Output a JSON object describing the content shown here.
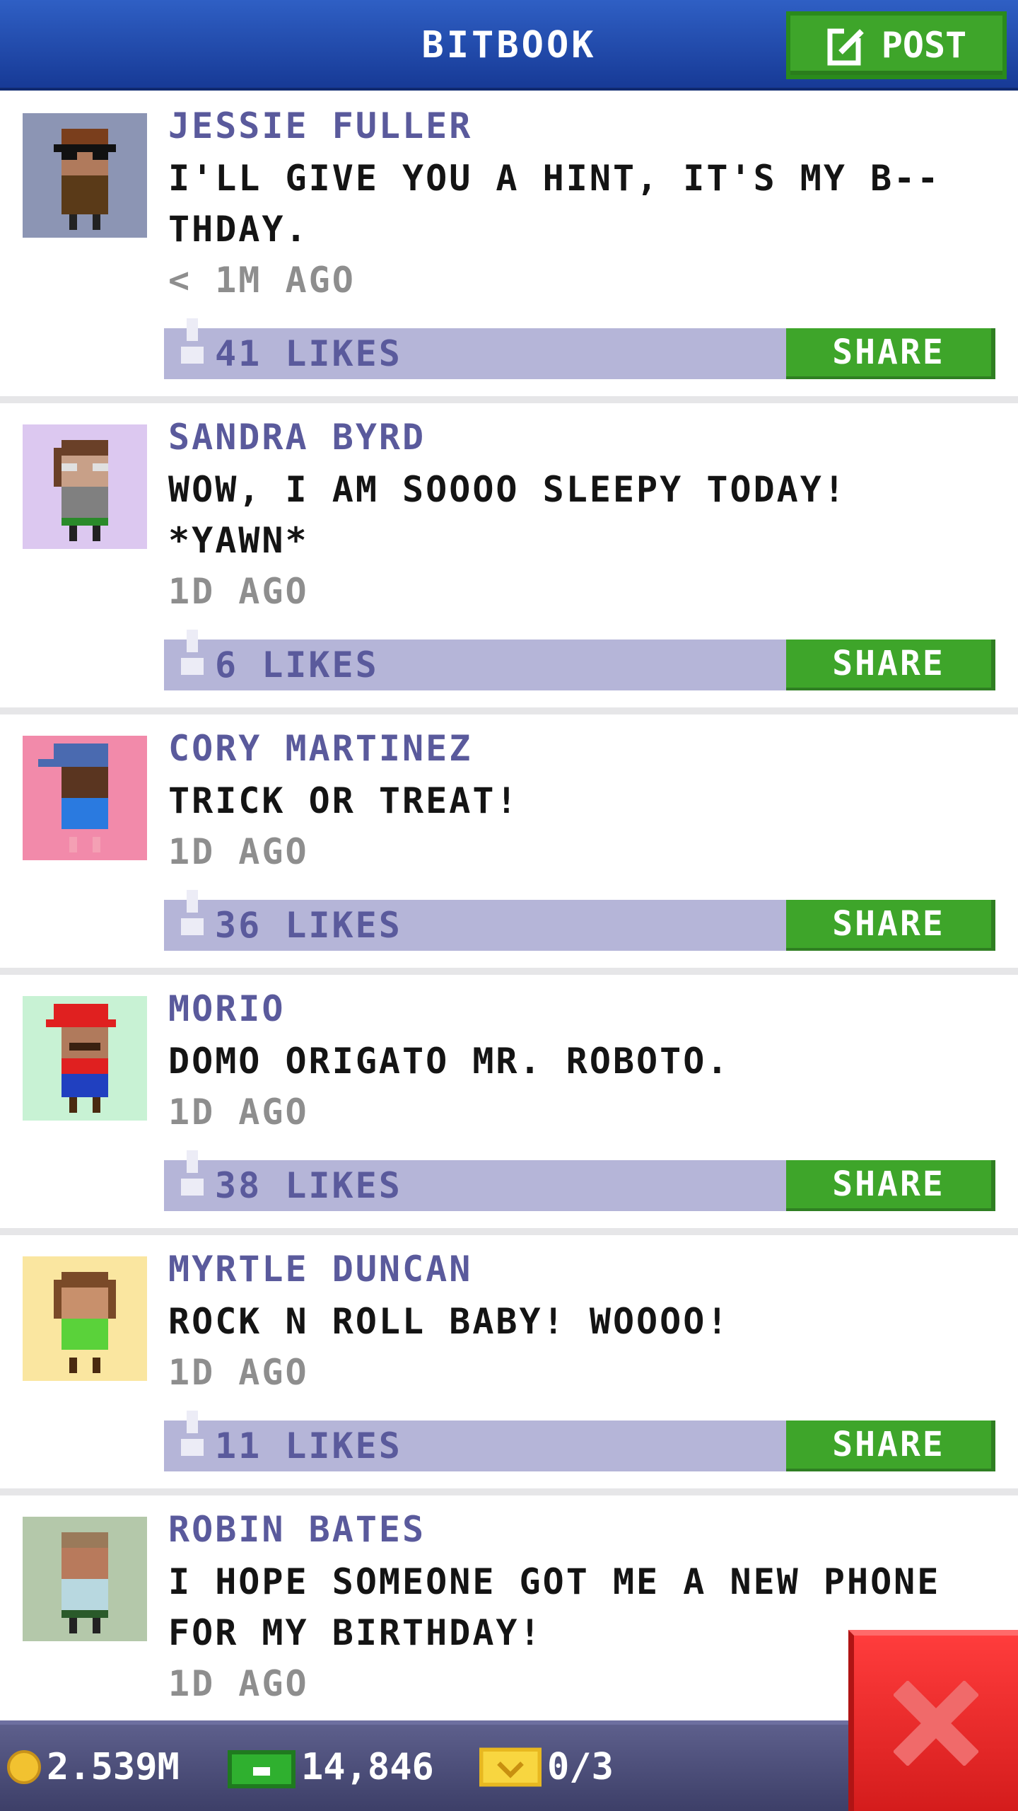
{
  "header": {
    "title": "BITBOOK",
    "post_label": "POST"
  },
  "posts": [
    {
      "author": "JESSIE FULLER",
      "message": "I'LL GIVE YOU A HINT, IT'S MY B--THDAY.",
      "time": "< 1M AGO",
      "likes": "41 LIKES",
      "share": "SHARE",
      "avatar_bg": "#8c95b4"
    },
    {
      "author": "SANDRA BYRD",
      "message": "WOW, I AM SOOOO SLEEPY TODAY! *YAWN*",
      "time": "1D AGO",
      "likes": "6 LIKES",
      "share": "SHARE",
      "avatar_bg": "#dcc8f0"
    },
    {
      "author": "CORY MARTINEZ",
      "message": "TRICK OR TREAT!",
      "time": "1D AGO",
      "likes": "36 LIKES",
      "share": "SHARE",
      "avatar_bg": "#f28aaa"
    },
    {
      "author": "MORIO",
      "message": "DOMO ORIGATO MR. ROBOTO.",
      "time": "1D AGO",
      "likes": "38 LIKES",
      "share": "SHARE",
      "avatar_bg": "#c8f2d4"
    },
    {
      "author": "MYRTLE DUNCAN",
      "message": "ROCK N ROLL BABY! WOOOO!",
      "time": "1D AGO",
      "likes": "11 LIKES",
      "share": "SHARE",
      "avatar_bg": "#fae6a0"
    },
    {
      "author": "ROBIN BATES",
      "message": "I HOPE SOMEONE GOT ME A NEW PHONE FOR MY BIRTHDAY!",
      "time": "1D AGO",
      "avatar_bg": "#b4c8aa"
    }
  ],
  "status": {
    "coins": "2.539M",
    "bux": "14,846",
    "vip": "0/3"
  },
  "colors": {
    "accent_green": "#3ea52a",
    "header_blue": "#1f49b0",
    "close_red": "#e62424"
  }
}
